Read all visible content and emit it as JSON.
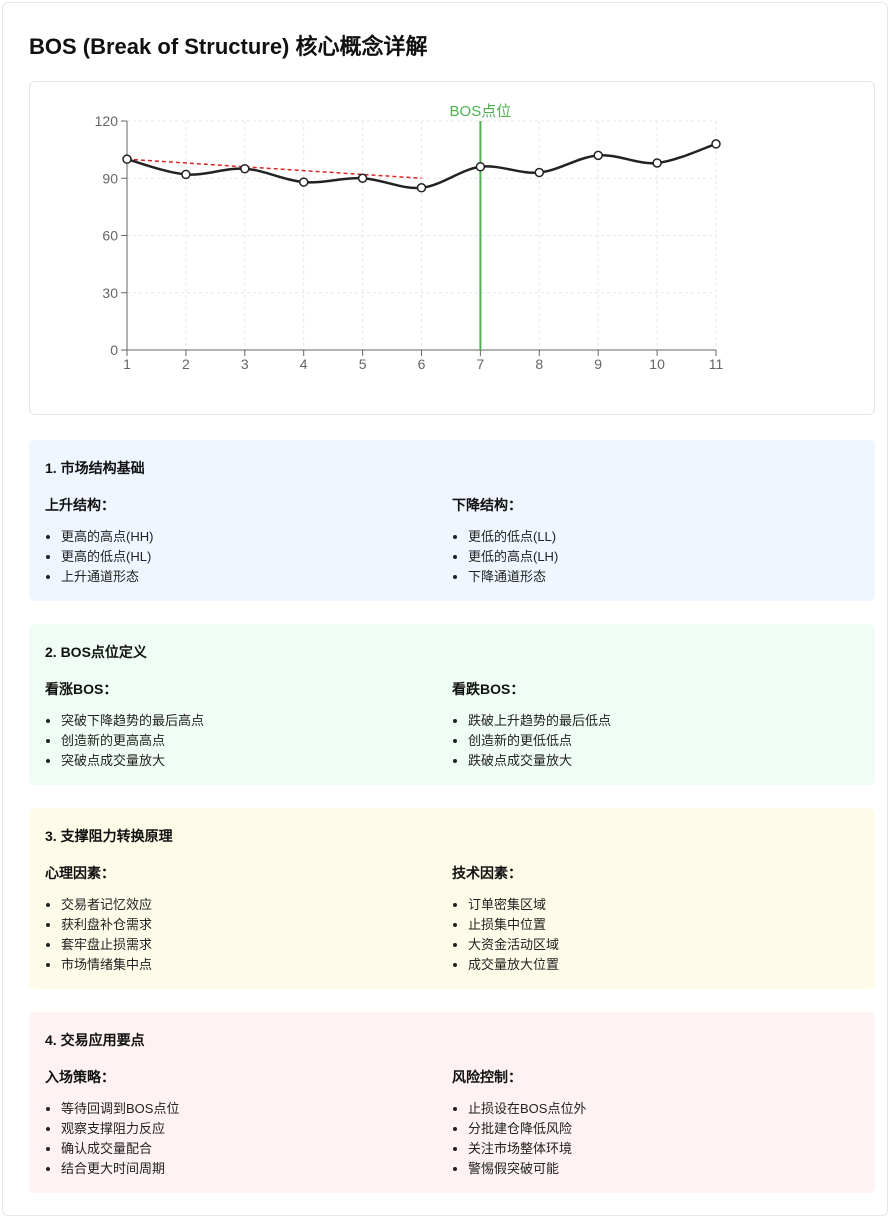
{
  "title": "BOS (Break of Structure) 核心概念详解",
  "chart_data": {
    "type": "line",
    "x": [
      1,
      2,
      3,
      4,
      5,
      6,
      7,
      8,
      9,
      10,
      11
    ],
    "series": [
      {
        "values": [
          100,
          92,
          95,
          88,
          90,
          85,
          96,
          93,
          102,
          98,
          108
        ],
        "color": "#222222"
      }
    ],
    "trendline": {
      "x": [
        1,
        6
      ],
      "y": [
        100,
        90
      ],
      "color": "#dc2626",
      "style": "dashed"
    },
    "annotation": {
      "x": 7,
      "label": "BOS点位",
      "color": "#4caf50"
    },
    "xlim": [
      1,
      11
    ],
    "ylim": [
      0,
      120
    ],
    "yticks": [
      0,
      30,
      60,
      90,
      120
    ],
    "xticks": [
      1,
      2,
      3,
      4,
      5,
      6,
      7,
      8,
      9,
      10,
      11
    ],
    "grid": true
  },
  "sections": [
    {
      "heading": "1. 市场结构基础",
      "left": {
        "title": "上升结构：",
        "items": [
          "更高的高点(HH)",
          "更高的低点(HL)",
          "上升通道形态"
        ]
      },
      "right": {
        "title": "下降结构：",
        "items": [
          "更低的低点(LL)",
          "更低的高点(LH)",
          "下降通道形态"
        ]
      }
    },
    {
      "heading": "2. BOS点位定义",
      "left": {
        "title": "看涨BOS：",
        "items": [
          "突破下降趋势的最后高点",
          "创造新的更高高点",
          "突破点成交量放大"
        ]
      },
      "right": {
        "title": "看跌BOS：",
        "items": [
          "跌破上升趋势的最后低点",
          "创造新的更低低点",
          "跌破点成交量放大"
        ]
      }
    },
    {
      "heading": "3. 支撑阻力转换原理",
      "left": {
        "title": "心理因素：",
        "items": [
          "交易者记忆效应",
          "获利盘补仓需求",
          "套牢盘止损需求",
          "市场情绪集中点"
        ]
      },
      "right": {
        "title": "技术因素：",
        "items": [
          "订单密集区域",
          "止损集中位置",
          "大资金活动区域",
          "成交量放大位置"
        ]
      }
    },
    {
      "heading": "4. 交易应用要点",
      "left": {
        "title": "入场策略：",
        "items": [
          "等待回调到BOS点位",
          "观察支撑阻力反应",
          "确认成交量配合",
          "结合更大时间周期"
        ]
      },
      "right": {
        "title": "风险控制：",
        "items": [
          "止损设在BOS点位外",
          "分批建仓降低风险",
          "关注市场整体环境",
          "警惕假突破可能"
        ]
      }
    }
  ]
}
